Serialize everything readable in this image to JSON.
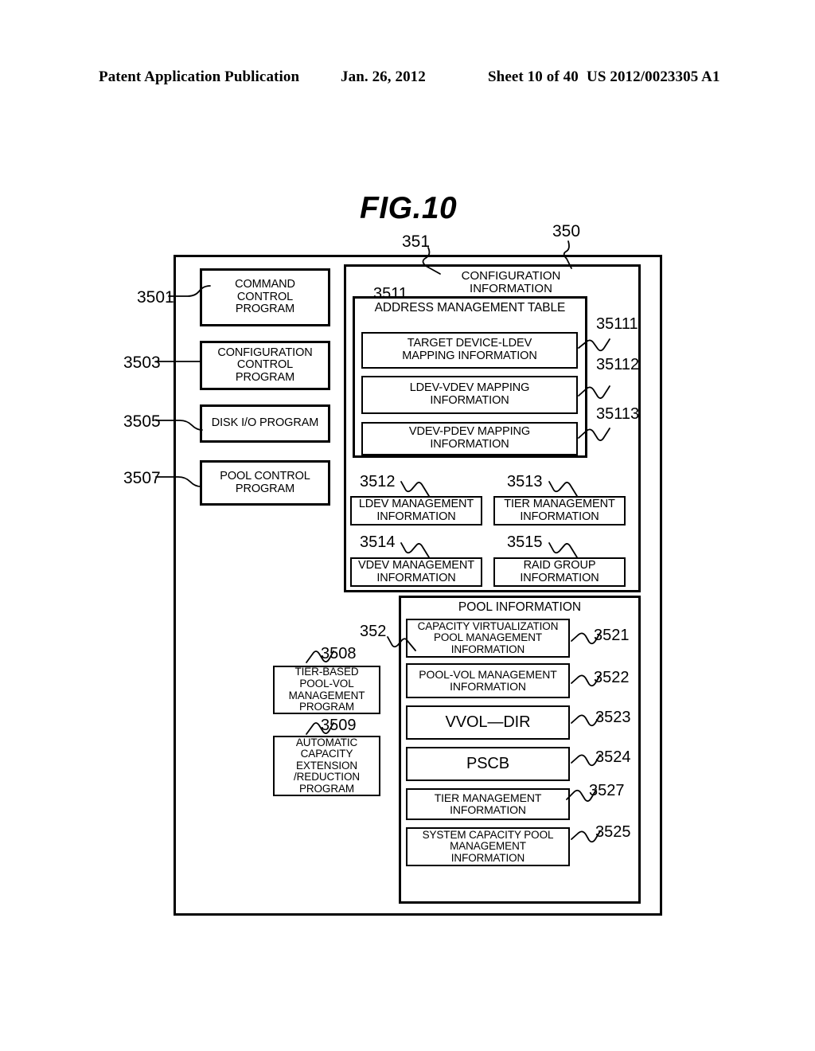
{
  "header": {
    "publication": "Patent Application Publication",
    "date": "Jan. 26, 2012",
    "sheet": "Sheet 10 of 40",
    "patent_number": "US 2012/0023305 A1"
  },
  "figure": {
    "title": "FIG.10",
    "outer_ref": "350",
    "config_container_ref": "351",
    "pool_container_ref": "352"
  },
  "programs": [
    {
      "ref": "3501",
      "label": "COMMAND\nCONTROL\nPROGRAM"
    },
    {
      "ref": "3503",
      "label": "CONFIGURATION\nCONTROL\nPROGRAM"
    },
    {
      "ref": "3505",
      "label": "DISK I/O PROGRAM"
    },
    {
      "ref": "3507",
      "label": "POOL CONTROL\nPROGRAM"
    }
  ],
  "lower_programs": [
    {
      "ref": "3508",
      "label": "TIER-BASED\nPOOL-VOL\nMANAGEMENT\nPROGRAM"
    },
    {
      "ref": "3509",
      "label": "AUTOMATIC\nCAPACITY\nEXTENSION\n/REDUCTION\nPROGRAM"
    }
  ],
  "configuration_information": {
    "title": "CONFIGURATION\nINFORMATION",
    "address_management_table": {
      "ref": "3511",
      "title": "ADDRESS MANAGEMENT TABLE",
      "entries": [
        {
          "ref": "35111",
          "label": "TARGET DEVICE-LDEV\nMAPPING INFORMATION"
        },
        {
          "ref": "35112",
          "label": "LDEV-VDEV MAPPING\nINFORMATION"
        },
        {
          "ref": "35113",
          "label": "VDEV-PDEV MAPPING\nINFORMATION"
        }
      ]
    },
    "management_info": [
      {
        "ref": "3512",
        "label": "LDEV MANAGEMENT\nINFORMATION"
      },
      {
        "ref": "3513",
        "label": "TIER MANAGEMENT\nINFORMATION"
      },
      {
        "ref": "3514",
        "label": "VDEV MANAGEMENT\nINFORMATION"
      },
      {
        "ref": "3515",
        "label": "RAID GROUP\nINFORMATION"
      }
    ]
  },
  "pool_information": {
    "title": "POOL INFORMATION",
    "entries": [
      {
        "ref": "3521",
        "label": "CAPACITY VIRTUALIZATION\nPOOL MANAGEMENT\nINFORMATION"
      },
      {
        "ref": "3522",
        "label": "POOL-VOL MANAGEMENT\nINFORMATION"
      },
      {
        "ref": "3523",
        "label": "VVOL—DIR"
      },
      {
        "ref": "3524",
        "label": "PSCB"
      },
      {
        "ref": "3527",
        "label": "TIER MANAGEMENT\nINFORMATION"
      },
      {
        "ref": "3525",
        "label": "SYSTEM CAPACITY POOL\nMANAGEMENT\nINFORMATION"
      }
    ]
  }
}
